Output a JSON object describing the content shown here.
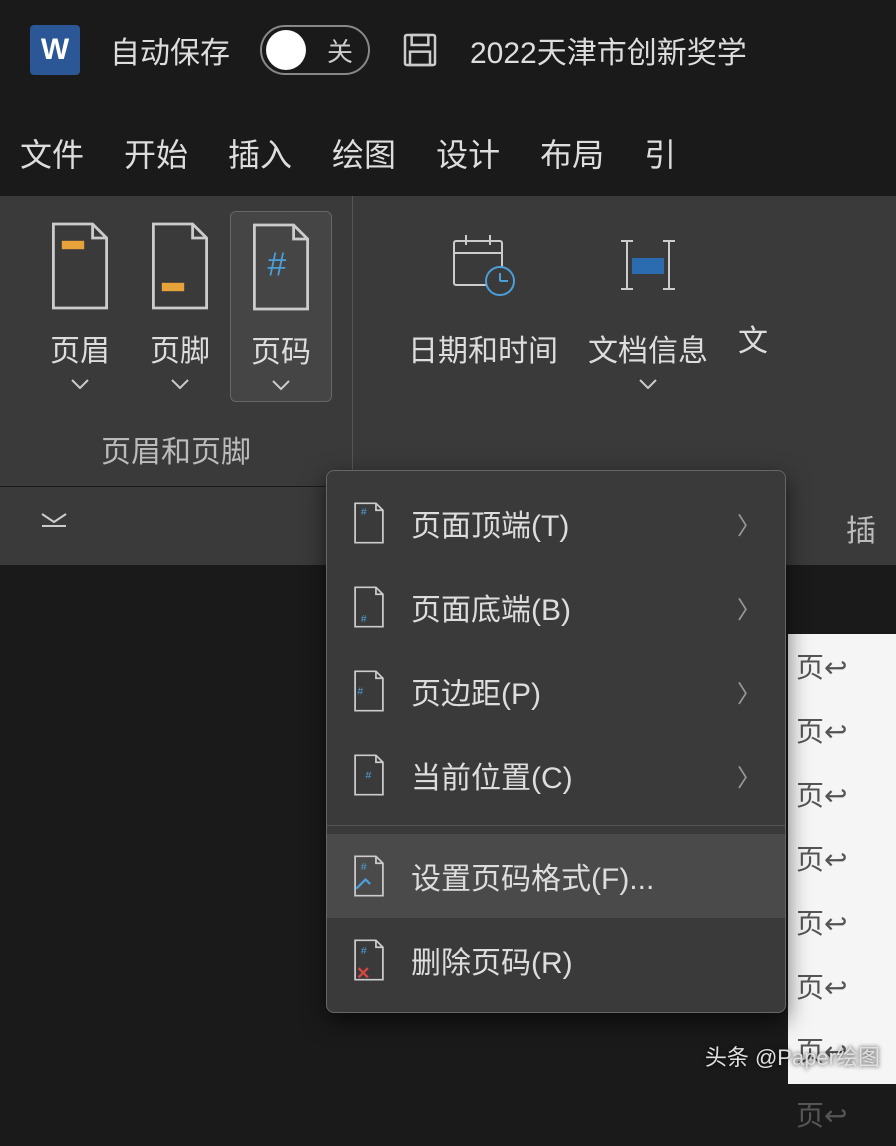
{
  "titlebar": {
    "autosave": "自动保存",
    "toggle_state": "关",
    "document_title": "2022天津市创新奖学"
  },
  "tabs": {
    "items": [
      "文件",
      "开始",
      "插入",
      "绘图",
      "设计",
      "布局",
      "引"
    ]
  },
  "ribbon": {
    "header_footer": {
      "header": "页眉",
      "footer": "页脚",
      "page_number": "页码",
      "section_label": "页眉和页脚"
    },
    "insert_group": {
      "date_time": "日期和时间",
      "doc_info": "文档信息",
      "text_partial": "文",
      "section_label": "插"
    }
  },
  "dropdown": {
    "items": [
      {
        "label": "页面顶端(T)",
        "arrow": true
      },
      {
        "label": "页面底端(B)",
        "arrow": true
      },
      {
        "label": "页边距(P)",
        "arrow": true
      },
      {
        "label": "当前位置(C)",
        "arrow": true
      },
      {
        "label": "设置页码格式(F)...",
        "arrow": false,
        "hover": true
      },
      {
        "label": "删除页码(R)",
        "arrow": false
      }
    ]
  },
  "document": {
    "lines": [
      "页↩",
      "页↩",
      "页↩",
      "页↩",
      "页↩",
      "页↩",
      "页↩",
      "页↩"
    ]
  },
  "watermark": "头条 @Paper绘图"
}
